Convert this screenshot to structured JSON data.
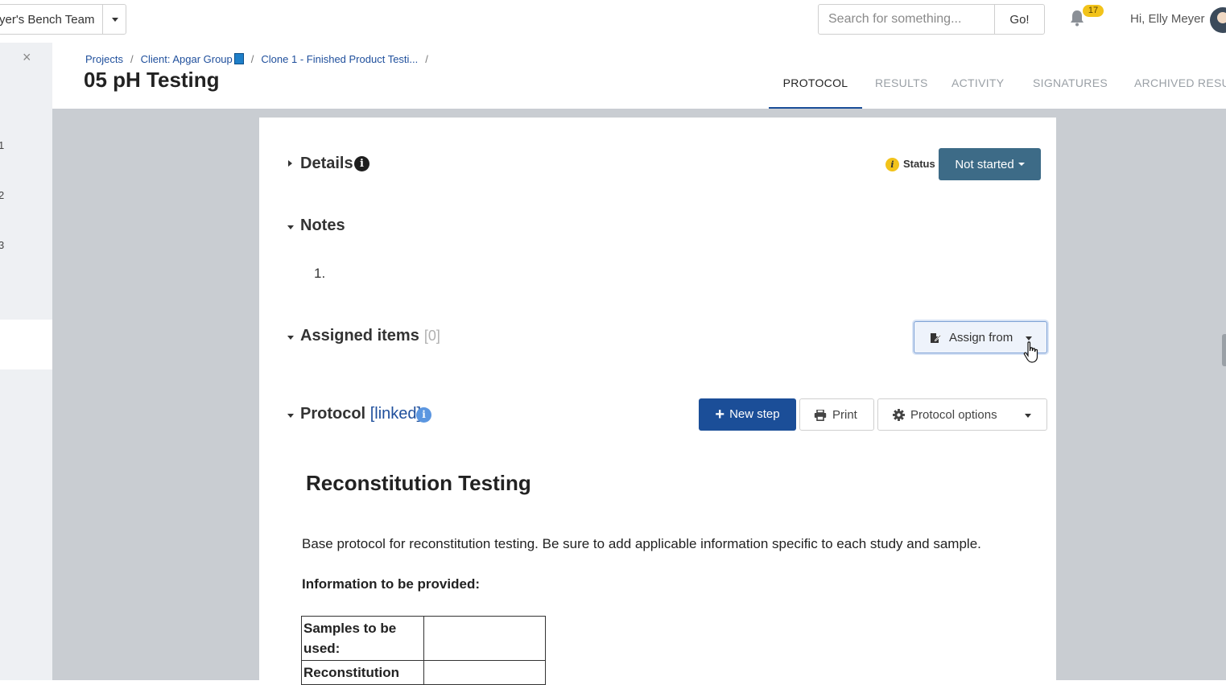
{
  "topbar": {
    "team_name": "yer's Bench Team",
    "search_placeholder": "Search for something...",
    "go_label": "Go!",
    "notification_count": "17",
    "greeting": "Hi, Elly Meyer"
  },
  "left_panel": {
    "close_glyph": "×",
    "numbers": [
      "1",
      "2",
      "3"
    ]
  },
  "breadcrumb": {
    "items": [
      "Projects",
      "Client: Apgar Group",
      "Clone 1 - Finished Product Testi..."
    ],
    "separator": "/"
  },
  "page_title": "05 pH Testing",
  "tabs": [
    {
      "label": "PROTOCOL",
      "active": true
    },
    {
      "label": "RESULTS",
      "active": false
    },
    {
      "label": "ACTIVITY",
      "active": false
    },
    {
      "label": "SIGNATURES",
      "active": false
    },
    {
      "label": "ARCHIVED RESULTS",
      "active": false
    }
  ],
  "details": {
    "title": "Details",
    "info_glyph": "i",
    "status_icon_glyph": "i",
    "status_label": "Status",
    "status_value": "Not started"
  },
  "notes": {
    "title": "Notes",
    "item_number": "1."
  },
  "assigned_items": {
    "title": "Assigned items",
    "count": "[0]",
    "assign_button": "Assign from"
  },
  "protocol": {
    "title": "Protocol",
    "linked": "[linked]",
    "info_glyph": "i",
    "new_step_plus": "+",
    "new_step": "New step",
    "print": "Print",
    "options": "Protocol options",
    "heading": "Reconstitution Testing",
    "description": "Base protocol for reconstitution testing. Be sure to add applicable information specific to each study and sample.",
    "subheading": "Information to be provided:",
    "table": [
      {
        "label": "Samples to be used:",
        "value": ""
      },
      {
        "label": "Reconstitution",
        "value": ""
      }
    ]
  },
  "colors": {
    "primary": "#1b4e98",
    "status_button": "#3d6b87",
    "badge": "#f2c31a",
    "link": "#1f4f9c",
    "content_bg": "#c9cdd2"
  },
  "icons": [
    "caret-down-icon",
    "bell-icon",
    "avatar",
    "close-icon",
    "book-icon",
    "info-icon",
    "warning-info-icon",
    "assign-icon",
    "plus-icon",
    "print-icon",
    "gear-icon",
    "pointer-cursor-icon"
  ]
}
